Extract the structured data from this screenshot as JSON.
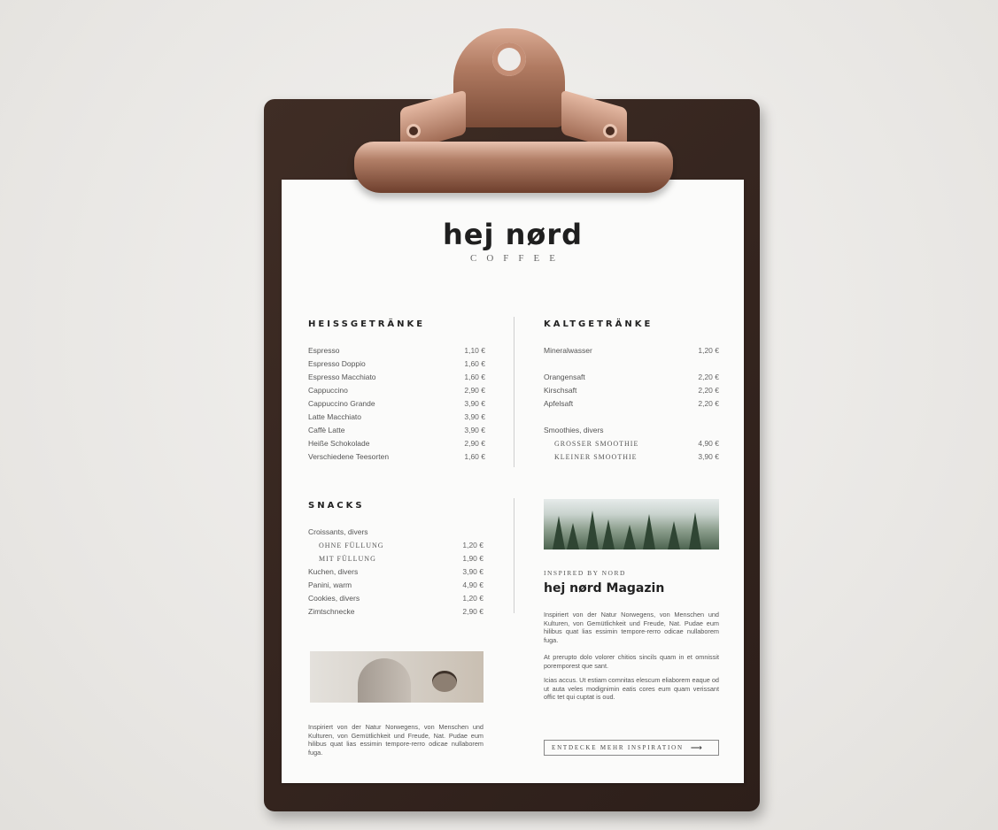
{
  "brand": {
    "name": "hej nørd",
    "subtitle": "COFFEE"
  },
  "hot_drinks": {
    "title": "HEISSGETRÄNKE",
    "items": [
      {
        "name": "Espresso",
        "price": "1,10 €"
      },
      {
        "name": "Espresso Doppio",
        "price": "1,60 €"
      },
      {
        "name": "Espresso Macchiato",
        "price": "1,60 €"
      },
      {
        "name": "Cappuccino",
        "price": "2,90 €"
      },
      {
        "name": "Cappuccino Grande",
        "price": "3,90 €"
      },
      {
        "name": "Latte Macchiato",
        "price": "3,90 €"
      },
      {
        "name": "Caffè Latte",
        "price": "3,90 €"
      },
      {
        "name": "Heiße Schokolade",
        "price": "2,90 €"
      },
      {
        "name": "Verschiedene Teesorten",
        "price": "1,60 €"
      }
    ]
  },
  "cold_drinks": {
    "title": "KALTGETRÄNKE",
    "items": [
      {
        "name": "Mineralwasser",
        "price": "1,20 €"
      },
      {
        "name": "Orangensaft",
        "price": "2,20 €"
      },
      {
        "name": "Kirschsaft",
        "price": "2,20 €"
      },
      {
        "name": "Apfelsaft",
        "price": "2,20 €"
      },
      {
        "name": "Smoothies, divers",
        "price": ""
      },
      {
        "name": "GROSSER SMOOTHIE",
        "price": "4,90 €"
      },
      {
        "name": "KLEINER SMOOTHIE",
        "price": "3,90 €"
      }
    ]
  },
  "snacks": {
    "title": "SNACKS",
    "items": [
      {
        "name": "Croissants, divers",
        "price": ""
      },
      {
        "name": "OHNE FÜLLUNG",
        "price": "1,20 €"
      },
      {
        "name": "MIT FÜLLUNG",
        "price": "1,90 €"
      },
      {
        "name": "Kuchen, divers",
        "price": "3,90 €"
      },
      {
        "name": "Panini, warm",
        "price": "4,90 €"
      },
      {
        "name": "Cookies, divers",
        "price": "1,20 €"
      },
      {
        "name": "Zimtschnecke",
        "price": "2,90 €"
      }
    ]
  },
  "snacks_text": "Inspiriert von der Natur Norwegens, von Menschen und Kulturen, von Gemütlichkeit und Freude, Nat. Pudae eum hilibus quat lias essimin tempore-rerro odicae nullaborem fuga.",
  "magazine": {
    "kicker": "INSPIRED BY NORD",
    "title": "hej nørd Magazin",
    "p1": "Inspiriert von der Natur Norwegens, von Menschen und Kulturen, von Gemütlichkeit und Freude, Nat. Pudae eum hilibus quat lias essimin tempore-rerro odicae nullaborem fuga.",
    "p2": "At prerupto dolo volorer chitios sincils quam in et omnissit poremporest que sant.",
    "p3": "Icias accus. Ut estiam comnitas elescum eliaborem eaque od ut auta veles modignimin eatis cores eum quam verissant offic tet qui cuptat is oud.",
    "cta": "ENTDECKE MEHR INSPIRATION"
  }
}
